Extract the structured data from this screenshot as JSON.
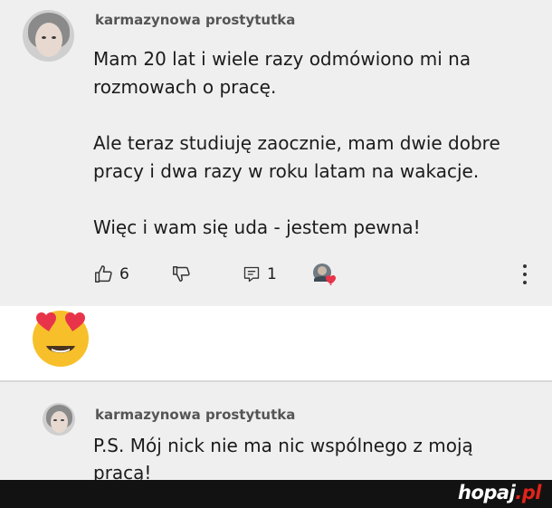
{
  "comment_main": {
    "username": "karmazynowa prostytutka",
    "text": "Mam 20 lat i wiele razy odmówiono mi na\nrozmowach o pracę.\n\nAle teraz studiuję zaocznie, mam dwie dobre\npracy i dwa razy w roku latam na wakacje.\n\nWięc i wam się uda - jestem pewna!",
    "likes": "6",
    "replies": "1",
    "icons": [
      "thumbs-up-icon",
      "thumbs-down-icon",
      "reply-icon",
      "creator-heart-icon",
      "more-vert-icon"
    ]
  },
  "reaction": {
    "icon": "heart-eyes-emoji"
  },
  "comment_reply": {
    "username": "karmazynowa prostytutka",
    "text": "P.S. Mój nick nie ma nic wspólnego z moją\npracą!"
  },
  "footer": {
    "brand_main": "hopaj",
    "brand_tld": ".pl"
  },
  "colors": {
    "card_bg": "#efefef",
    "footer_bg": "#121212",
    "brand_accent": "#e2231a",
    "emoji_yellow": "#f7c02b",
    "heart_red": "#e8344a"
  }
}
